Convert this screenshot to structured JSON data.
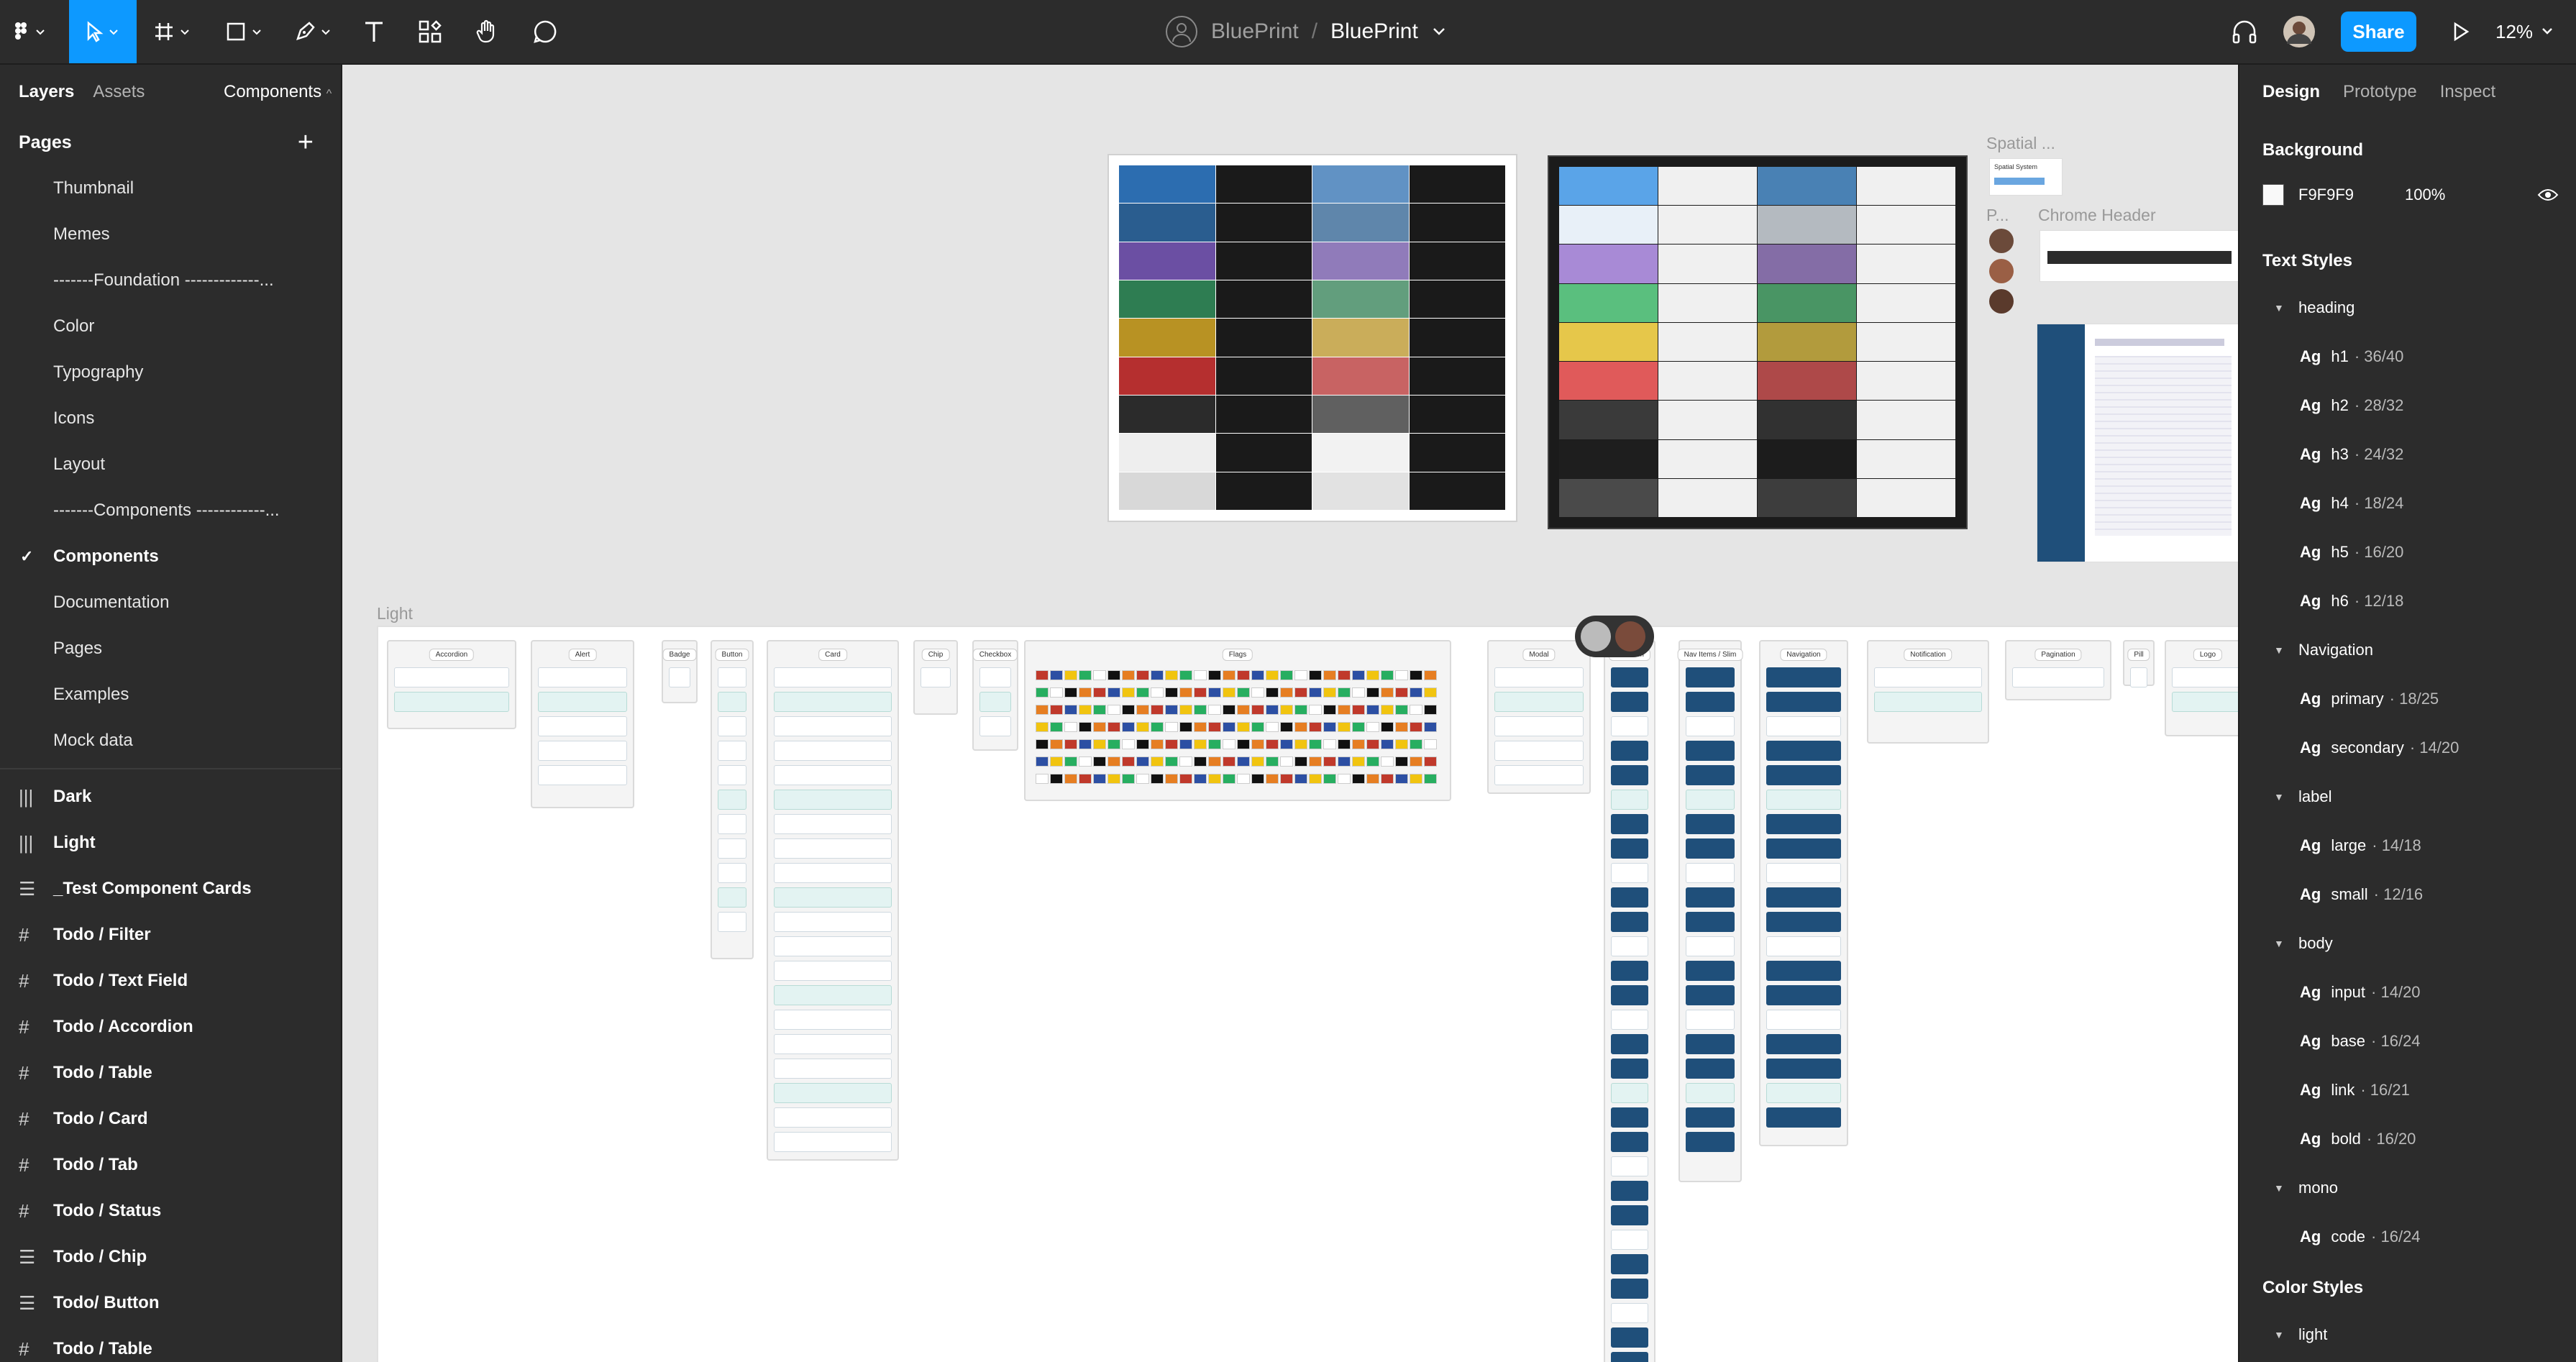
{
  "toolbar": {
    "file_owner": "BluePrint",
    "separator": "/",
    "file_name": "BluePrint",
    "share_label": "Share",
    "zoom": "12%"
  },
  "left_panel": {
    "tabs": [
      "Layers",
      "Assets"
    ],
    "page_switcher": "Components",
    "pages_heading": "Pages",
    "pages": [
      {
        "label": "Thumbnail",
        "current": false
      },
      {
        "label": "Memes",
        "current": false
      },
      {
        "label": "-------Foundation -------------...",
        "current": false
      },
      {
        "label": "Color",
        "current": false
      },
      {
        "label": "Typography",
        "current": false
      },
      {
        "label": "Icons",
        "current": false
      },
      {
        "label": "Layout",
        "current": false
      },
      {
        "label": "-------Components ------------...",
        "current": false
      },
      {
        "label": "Components",
        "current": true
      },
      {
        "label": "Documentation",
        "current": false
      },
      {
        "label": "Pages",
        "current": false
      },
      {
        "label": "Examples",
        "current": false
      },
      {
        "label": "Mock data",
        "current": false
      }
    ],
    "layers": [
      {
        "label": "Dark",
        "icon": "columns-icon"
      },
      {
        "label": "Light",
        "icon": "columns-icon"
      },
      {
        "label": "_Test Component Cards",
        "icon": "rows-icon"
      },
      {
        "label": "Todo / Filter",
        "icon": "frame-icon"
      },
      {
        "label": "Todo / Text Field",
        "icon": "frame-icon"
      },
      {
        "label": "Todo / Accordion",
        "icon": "frame-icon"
      },
      {
        "label": "Todo / Table",
        "icon": "frame-icon"
      },
      {
        "label": "Todo / Card",
        "icon": "frame-icon"
      },
      {
        "label": "Todo / Tab",
        "icon": "frame-icon"
      },
      {
        "label": "Todo / Status",
        "icon": "frame-icon"
      },
      {
        "label": "Todo / Chip",
        "icon": "rows-icon"
      },
      {
        "label": "Todo/ Button",
        "icon": "rows-icon"
      },
      {
        "label": "Todo / Table",
        "icon": "frame-icon"
      }
    ]
  },
  "canvas": {
    "labels": {
      "spatial": "Spatial ...",
      "spatial_sub": "Spatial System",
      "p_short": "P...",
      "chrome_header": "Chrome Header",
      "light_frame": "Light"
    },
    "component_cards": [
      "Accordion",
      "Alert",
      "Badge",
      "Button",
      "Card",
      "Chip",
      "Checkbox",
      "Flags",
      "Modal",
      "Nav Item",
      "Nav Items / Slim",
      "Navigation",
      "Notification",
      "Pagination",
      "Pill",
      "Logo"
    ],
    "light_palette_colors": [
      "#2c6db0",
      "#2a5d8f",
      "#6b4fa3",
      "#2e7d52",
      "#b89223",
      "#b52f2f",
      "#2b2b2b",
      "#eeeeee",
      "#d8d8d8"
    ],
    "dark_palette_colors": [
      "#5aa4e8",
      "#e8f0f8",
      "#a88ad6",
      "#5abf7e",
      "#e6c74a",
      "#e05a5a",
      "#3a3a3a",
      "#1e1e1e",
      "#4a4a4a"
    ]
  },
  "right_panel": {
    "tabs": [
      "Design",
      "Prototype",
      "Inspect"
    ],
    "background_heading": "Background",
    "background_hex": "F9F9F9",
    "background_opacity": "100%",
    "text_styles_heading": "Text Styles",
    "groups": [
      {
        "name": "heading",
        "styles": [
          {
            "name": "h1",
            "size": "· 36/40"
          },
          {
            "name": "h2",
            "size": "· 28/32"
          },
          {
            "name": "h3",
            "size": "· 24/32"
          },
          {
            "name": "h4",
            "size": "· 18/24"
          },
          {
            "name": "h5",
            "size": "· 16/20"
          },
          {
            "name": "h6",
            "size": "· 12/18"
          }
        ]
      },
      {
        "name": "Navigation",
        "styles": [
          {
            "name": "primary",
            "size": "· 18/25"
          },
          {
            "name": "secondary",
            "size": "· 14/20"
          }
        ]
      },
      {
        "name": "label",
        "styles": [
          {
            "name": "large",
            "size": "· 14/18"
          },
          {
            "name": "small",
            "size": "· 12/16"
          }
        ]
      },
      {
        "name": "body",
        "styles": [
          {
            "name": "input",
            "size": "· 14/20"
          },
          {
            "name": "base",
            "size": "· 16/24"
          },
          {
            "name": "link",
            "size": "· 16/21"
          },
          {
            "name": "bold",
            "size": "· 16/20"
          }
        ]
      },
      {
        "name": "mono",
        "styles": [
          {
            "name": "code",
            "size": "· 16/24"
          }
        ]
      }
    ],
    "ag_label": "Ag",
    "color_styles_heading": "Color Styles",
    "color_group": "light"
  }
}
